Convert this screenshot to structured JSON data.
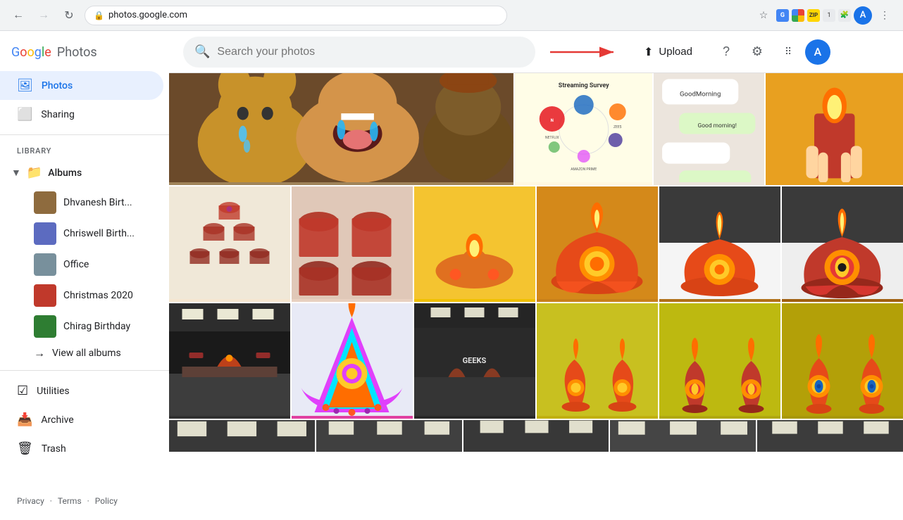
{
  "browser": {
    "url": "photos.google.com",
    "back_disabled": false,
    "forward_disabled": true
  },
  "header": {
    "app_name": "Photos",
    "search_placeholder": "Search your photos",
    "upload_label": "Upload",
    "help_icon": "?",
    "settings_icon": "⚙",
    "apps_icon": "⋮⋮⋮",
    "profile_initial": "A"
  },
  "sidebar": {
    "photos_label": "Photos",
    "sharing_label": "Sharing",
    "library_label": "LIBRARY",
    "albums_label": "Albums",
    "album_items": [
      {
        "name": "Dhvanesh Birt...",
        "color": "#8e6b3e"
      },
      {
        "name": "Chriswell Birth...",
        "color": "#5c6bc0"
      },
      {
        "name": "Office",
        "color": "#78909c"
      },
      {
        "name": "Christmas 2020",
        "color": "#c0392b"
      },
      {
        "name": "Chirag Birthday",
        "color": "#2e7d32"
      }
    ],
    "view_all_label": "View all albums",
    "utilities_label": "Utilities",
    "archive_label": "Archive",
    "trash_label": "Trash",
    "footer": {
      "privacy": "Privacy",
      "terms": "Terms",
      "policy": "Policy"
    }
  },
  "photos": {
    "rows": [
      {
        "cells": [
          {
            "color": "#c8a882",
            "wide": true,
            "label": "dogs"
          },
          {
            "color": "#e8c840",
            "label": "chart"
          },
          {
            "color": "#c0b090",
            "label": "whatsapp"
          },
          {
            "color": "#e8a020",
            "label": "candle"
          }
        ]
      },
      {
        "cells": [
          {
            "color": "#d4a080",
            "label": "cups tree"
          },
          {
            "color": "#c06050",
            "label": "cups"
          },
          {
            "color": "#e8c020",
            "label": "diya yellow"
          },
          {
            "color": "#e07820",
            "label": "diya large"
          },
          {
            "color": "#e05820",
            "label": "diya office"
          },
          {
            "color": "#d04010",
            "label": "diya3"
          }
        ]
      },
      {
        "cells": [
          {
            "color": "#404040",
            "label": "office room"
          },
          {
            "color": "#e060a0",
            "label": "diya pink"
          },
          {
            "color": "#383838",
            "label": "office2"
          },
          {
            "color": "#c8c020",
            "label": "diya yellow2"
          },
          {
            "color": "#c8c020",
            "label": "diya yellow3"
          },
          {
            "color": "#b0a020",
            "label": "diya yellow4"
          }
        ]
      },
      {
        "cells": [
          {
            "color": "#484848",
            "label": "ceiling1"
          },
          {
            "color": "#505050",
            "label": "ceiling2"
          },
          {
            "color": "#484848",
            "label": "ceiling3"
          },
          {
            "color": "#585858",
            "label": "ceiling4"
          },
          {
            "color": "#484848",
            "label": "ceiling5"
          }
        ]
      }
    ]
  }
}
